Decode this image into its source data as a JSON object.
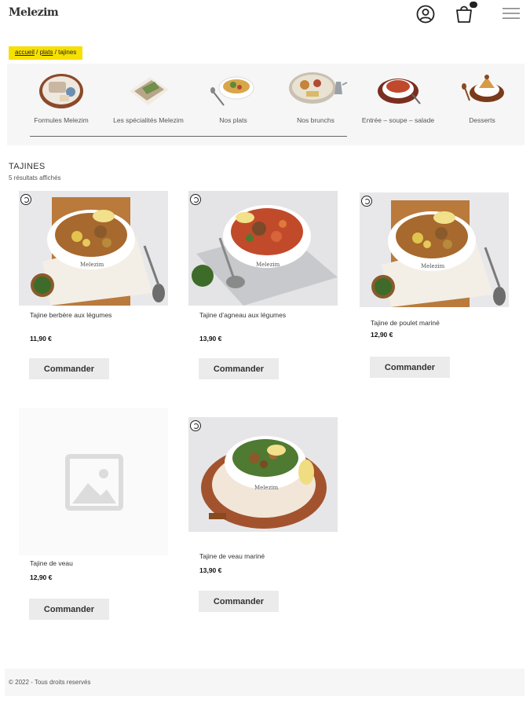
{
  "header": {
    "logo": "Melezim",
    "icons": [
      "user-icon",
      "cart-icon",
      "menu-icon"
    ]
  },
  "breadcrumb": {
    "home": "accueil",
    "sep1": " / ",
    "parent": "plats",
    "sep2": " / ",
    "current": "tajines"
  },
  "categories": [
    {
      "label": "Formules Melezim"
    },
    {
      "label": "Les spécialités Melezim"
    },
    {
      "label": "Nos plats"
    },
    {
      "label": "Nos brunchs"
    },
    {
      "label": "Entrée – soupe – salade"
    },
    {
      "label": "Desserts"
    }
  ],
  "section": {
    "title": "TAJINES",
    "count": "5 résultats affichés"
  },
  "products": [
    {
      "name": "Tajine berbère aux légumes",
      "price": "11,90 €",
      "button": "Commander"
    },
    {
      "name": "Tajine d’agneau aux légumes",
      "price": "13,90 €",
      "button": "Commander"
    },
    {
      "name": "Tajine de poulet mariné",
      "price": "12,90 €",
      "button": "Commander"
    },
    {
      "name": "Tajine de veau",
      "price": "12,90 €",
      "button": "Commander"
    },
    {
      "name": "Tajine de veau mariné",
      "price": "13,90 €",
      "button": "Commander"
    }
  ],
  "footer": {
    "text": "© 2022 - Tous droits reservés"
  },
  "colors": {
    "breadcrumb_bg": "#f6e000",
    "button_bg": "#ebebeb",
    "strip_bg": "#f6f6f6"
  }
}
